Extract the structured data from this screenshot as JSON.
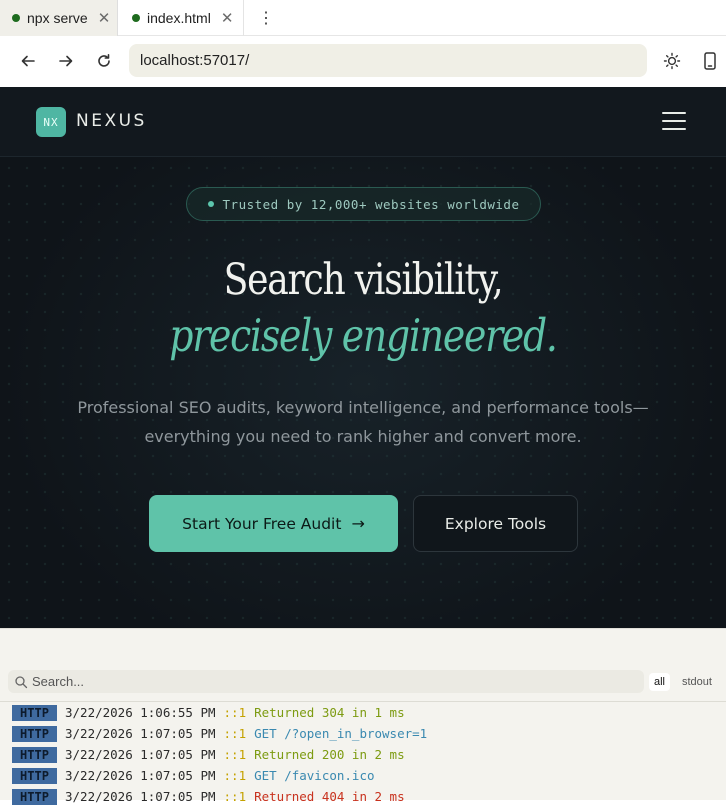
{
  "browser": {
    "tabs": [
      {
        "label": "npx serve",
        "active": true
      },
      {
        "label": "index.html",
        "active": false
      }
    ],
    "url": "localhost:57017/"
  },
  "site": {
    "logo_mark": "NX",
    "logo_text": "NEXUS",
    "badge": "Trusted by 12,000+ websites worldwide",
    "headline_line1": "Search visibility,",
    "headline_line2": "precisely engineered.",
    "subtext_line1": "Professional SEO audits, keyword intelligence, and performance tools—",
    "subtext_line2": "everything you need to rank higher and convert more.",
    "cta_primary": "Start Your Free Audit",
    "cta_primary_arrow": "→",
    "cta_secondary": "Explore Tools"
  },
  "terminal": {
    "search_placeholder": "Search...",
    "filters": [
      "all",
      "stdout"
    ],
    "logs": [
      {
        "tag": "HTTP",
        "time": "3/22/2026 1:06:55 PM",
        "addr": "::1",
        "message": "Returned 304 in 1 ms",
        "color": "green"
      },
      {
        "tag": "HTTP",
        "time": "3/22/2026 1:07:05 PM",
        "addr": "::1",
        "message": "GET /?open_in_browser=1",
        "color": "blue"
      },
      {
        "tag": "HTTP",
        "time": "3/22/2026 1:07:05 PM",
        "addr": "::1",
        "message": "Returned 200 in 2 ms",
        "color": "green"
      },
      {
        "tag": "HTTP",
        "time": "3/22/2026 1:07:05 PM",
        "addr": "::1",
        "message": "GET /favicon.ico",
        "color": "blue"
      },
      {
        "tag": "HTTP",
        "time": "3/22/2026 1:07:05 PM",
        "addr": "::1",
        "message": "Returned 404 in 2 ms",
        "color": "red"
      }
    ]
  },
  "colors": {
    "accent": "#5fc3a9",
    "page_bg": "#0f1419",
    "tab_dot": "#1e6b1e"
  }
}
